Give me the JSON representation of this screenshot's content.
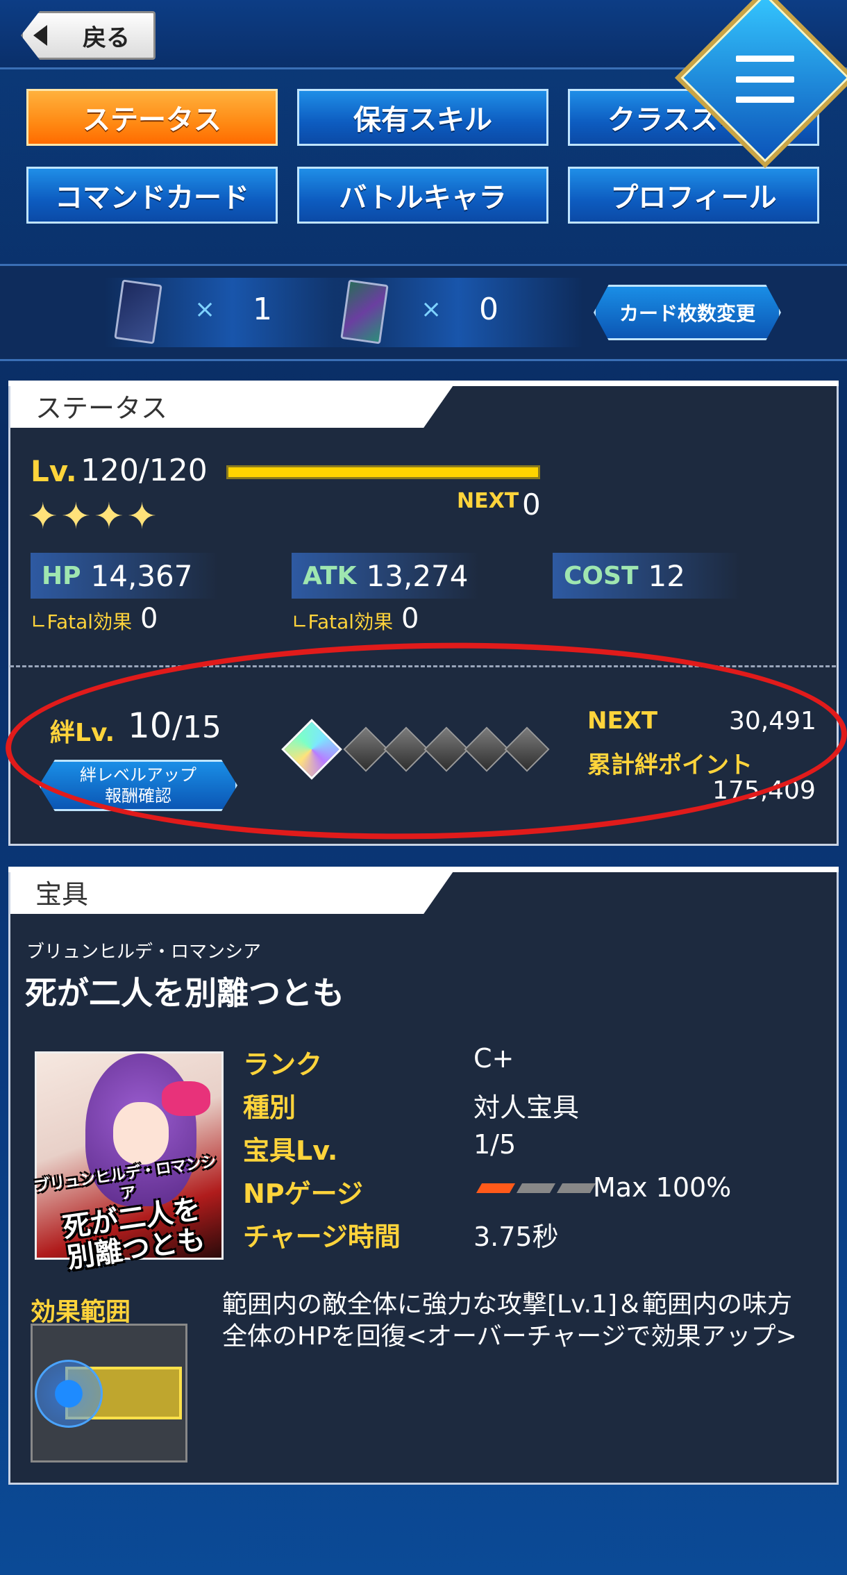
{
  "header": {
    "back_label": "戻る"
  },
  "tabs": [
    {
      "label": "ステータス",
      "active": true
    },
    {
      "label": "保有スキル",
      "active": false
    },
    {
      "label": "クラススキル",
      "active": false
    },
    {
      "label": "コマンドカード",
      "active": false
    },
    {
      "label": "バトルキャラ",
      "active": false
    },
    {
      "label": "プロフィール",
      "active": false
    }
  ],
  "card_counter": {
    "times": "×",
    "card1_count": "1",
    "card2_count": "0",
    "change_label": "カード枚数変更"
  },
  "status": {
    "panel_title": "ステータス",
    "lv_label": "Lv.",
    "lv_value": "120/120",
    "stars": 4,
    "next_label": "NEXT",
    "next_value": "0",
    "hp_key": "HP",
    "hp_value": "14,367",
    "atk_key": "ATK",
    "atk_value": "13,274",
    "cost_key": "COST",
    "cost_value": "12",
    "fatal_label": "∟Fatal効果",
    "hp_fatal": "0",
    "atk_fatal": "0",
    "bond_label": "絆Lv.",
    "bond_level": "10",
    "bond_max": "/15",
    "bond_button_line1": "絆レベルアップ",
    "bond_button_line2": "報酬確認",
    "bond_next_label": "NEXT",
    "bond_next_value": "30,491",
    "bond_total_label": "累計絆ポイント",
    "bond_total_value": "175,409"
  },
  "np": {
    "panel_title": "宝具",
    "ruby": "ブリュンヒルデ・ロマンシア",
    "name": "死が二人を別離つとも",
    "card_title_line1": "ブリュンヒルデ・ロマンシア",
    "card_title_line2": "死が二人を",
    "card_title_line3": "別離つとも",
    "rank_key": "ランク",
    "rank_value": "C+",
    "type_key": "種別",
    "type_value": "対人宝具",
    "lv_key": "宝具Lv.",
    "lv_value": "1/5",
    "gauge_key": "NPゲージ",
    "gauge_value": "Max 100%",
    "gauge_filled": 1,
    "gauge_total": 3,
    "charge_key": "チャージ時間",
    "charge_value": "3.75秒",
    "range_label": "効果範囲",
    "description": "範囲内の敵全体に強力な攻撃[Lv.1]＆範囲内の味方全体のHPを回復<オーバーチャージで効果アップ>"
  }
}
